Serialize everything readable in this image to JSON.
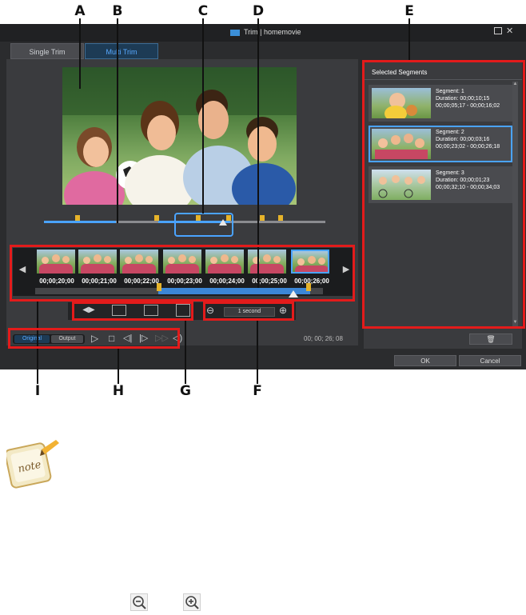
{
  "callouts": {
    "top": [
      "A",
      "B",
      "C",
      "D",
      "E"
    ],
    "bottom": [
      "I",
      "H",
      "G",
      "F"
    ]
  },
  "window": {
    "title": "Trim | homemovie"
  },
  "tabs": [
    {
      "label": "Single Trim"
    },
    {
      "label": "Multi Trim"
    }
  ],
  "timeline": {
    "timecodes": [
      "00;00;20;00",
      "00;00;21;00",
      "00;00;22;00",
      "00;00;23;00",
      "00;00;24;00",
      "00;00;25;00",
      "00;00;26;00"
    ]
  },
  "zoom": {
    "label": "1 second"
  },
  "playback": {
    "original_label": "Original",
    "output_label": "Output",
    "time_display": "00; 00; 26; 08"
  },
  "segments_panel": {
    "title": "Selected Segments",
    "items": [
      {
        "name": "Segment: 1",
        "duration": "Duration: 00;00;10;15",
        "range": "00;00;05;17 - 00;00;16;02"
      },
      {
        "name": "Segment: 2",
        "duration": "Duration: 00;00;03;16",
        "range": "00;00;23;02 - 00;00;26;18"
      },
      {
        "name": "Segment: 3",
        "duration": "Duration: 00;00;01;23",
        "range": "00;00;32;10 - 00;00;34;03"
      }
    ]
  },
  "dialog": {
    "ok_label": "OK",
    "cancel_label": "Cancel"
  },
  "colors": {
    "highlight_box": "#e31b1b",
    "accent_blue": "#4aa3ff",
    "in_out_marker": "#e6b32a"
  }
}
